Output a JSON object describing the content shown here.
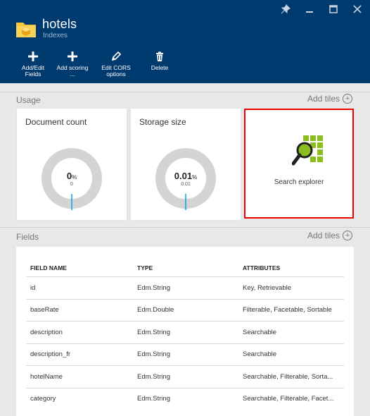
{
  "header": {
    "title": "hotels",
    "subtitle": "Indexes",
    "window_controls": [
      "pin-icon",
      "minimize-icon",
      "maximize-icon",
      "close-icon"
    ],
    "commands": [
      {
        "label": "Add/Edit Fields",
        "icon": "plus-icon"
      },
      {
        "label": "Add scoring ...",
        "icon": "plus-icon"
      },
      {
        "label": "Edit CORS options",
        "icon": "pencil-icon"
      },
      {
        "label": "Delete",
        "icon": "trash-icon"
      }
    ]
  },
  "usage": {
    "label": "Usage",
    "add_tiles": "Add tiles",
    "document_count": {
      "title": "Document count",
      "value": "0",
      "unit": "%",
      "sub": "0",
      "fraction": 0
    },
    "storage_size": {
      "title": "Storage size",
      "value": "0.01",
      "unit": "%",
      "sub": "0.01",
      "fraction": 0.0001
    },
    "search_explorer": {
      "label": "Search explorer"
    }
  },
  "fields": {
    "label": "Fields",
    "add_tiles": "Add tiles",
    "columns": [
      "FIELD NAME",
      "TYPE",
      "ATTRIBUTES"
    ],
    "rows": [
      [
        "id",
        "Edm.String",
        "Key, Retrievable"
      ],
      [
        "baseRate",
        "Edm.Double",
        "Filterable, Facetable, Sortable"
      ],
      [
        "description",
        "Edm.String",
        "Searchable"
      ],
      [
        "description_fr",
        "Edm.String",
        "Searchable"
      ],
      [
        "hotelName",
        "Edm.String",
        "Searchable, Filterable, Sorta..."
      ],
      [
        "category",
        "Edm.String",
        "Searchable, Filterable, Facet..."
      ]
    ]
  },
  "colors": {
    "header_bg": "#003b6f",
    "accent": "#00a1f1",
    "highlight": "#e00000",
    "search_green": "#8cbe1e"
  }
}
